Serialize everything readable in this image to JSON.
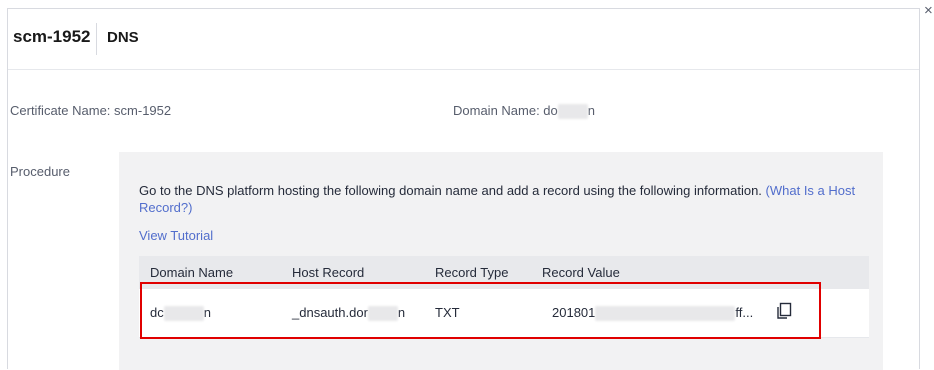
{
  "header": {
    "title": "scm-1952",
    "subtitle": "DNS"
  },
  "close_glyph": "×",
  "info": {
    "certificate_label": "Certificate Name: scm-1952",
    "domain_label_prefix": "Domain Name: do",
    "domain_label_suffix": "n"
  },
  "procedure": {
    "label": "Procedure",
    "instruction": "Go to the DNS platform hosting the following domain name and add a record using the following information. ",
    "instruction_link": "(What Is a Host Record?)",
    "tutorial_link": "View Tutorial"
  },
  "table": {
    "columns": [
      "Domain Name",
      "Host Record",
      "Record Type",
      "Record Value"
    ],
    "row": {
      "domain_prefix": "dc",
      "domain_suffix": "n",
      "host_prefix": "_dnsauth.dor",
      "host_suffix": "n",
      "record_type": "TXT",
      "value_prefix": "201801",
      "value_suffix": "ff..."
    }
  },
  "colors": {
    "accent": "#526ecc",
    "highlight": "#e00000"
  },
  "icons": {
    "close": "close-icon",
    "copy": "copy-icon"
  }
}
